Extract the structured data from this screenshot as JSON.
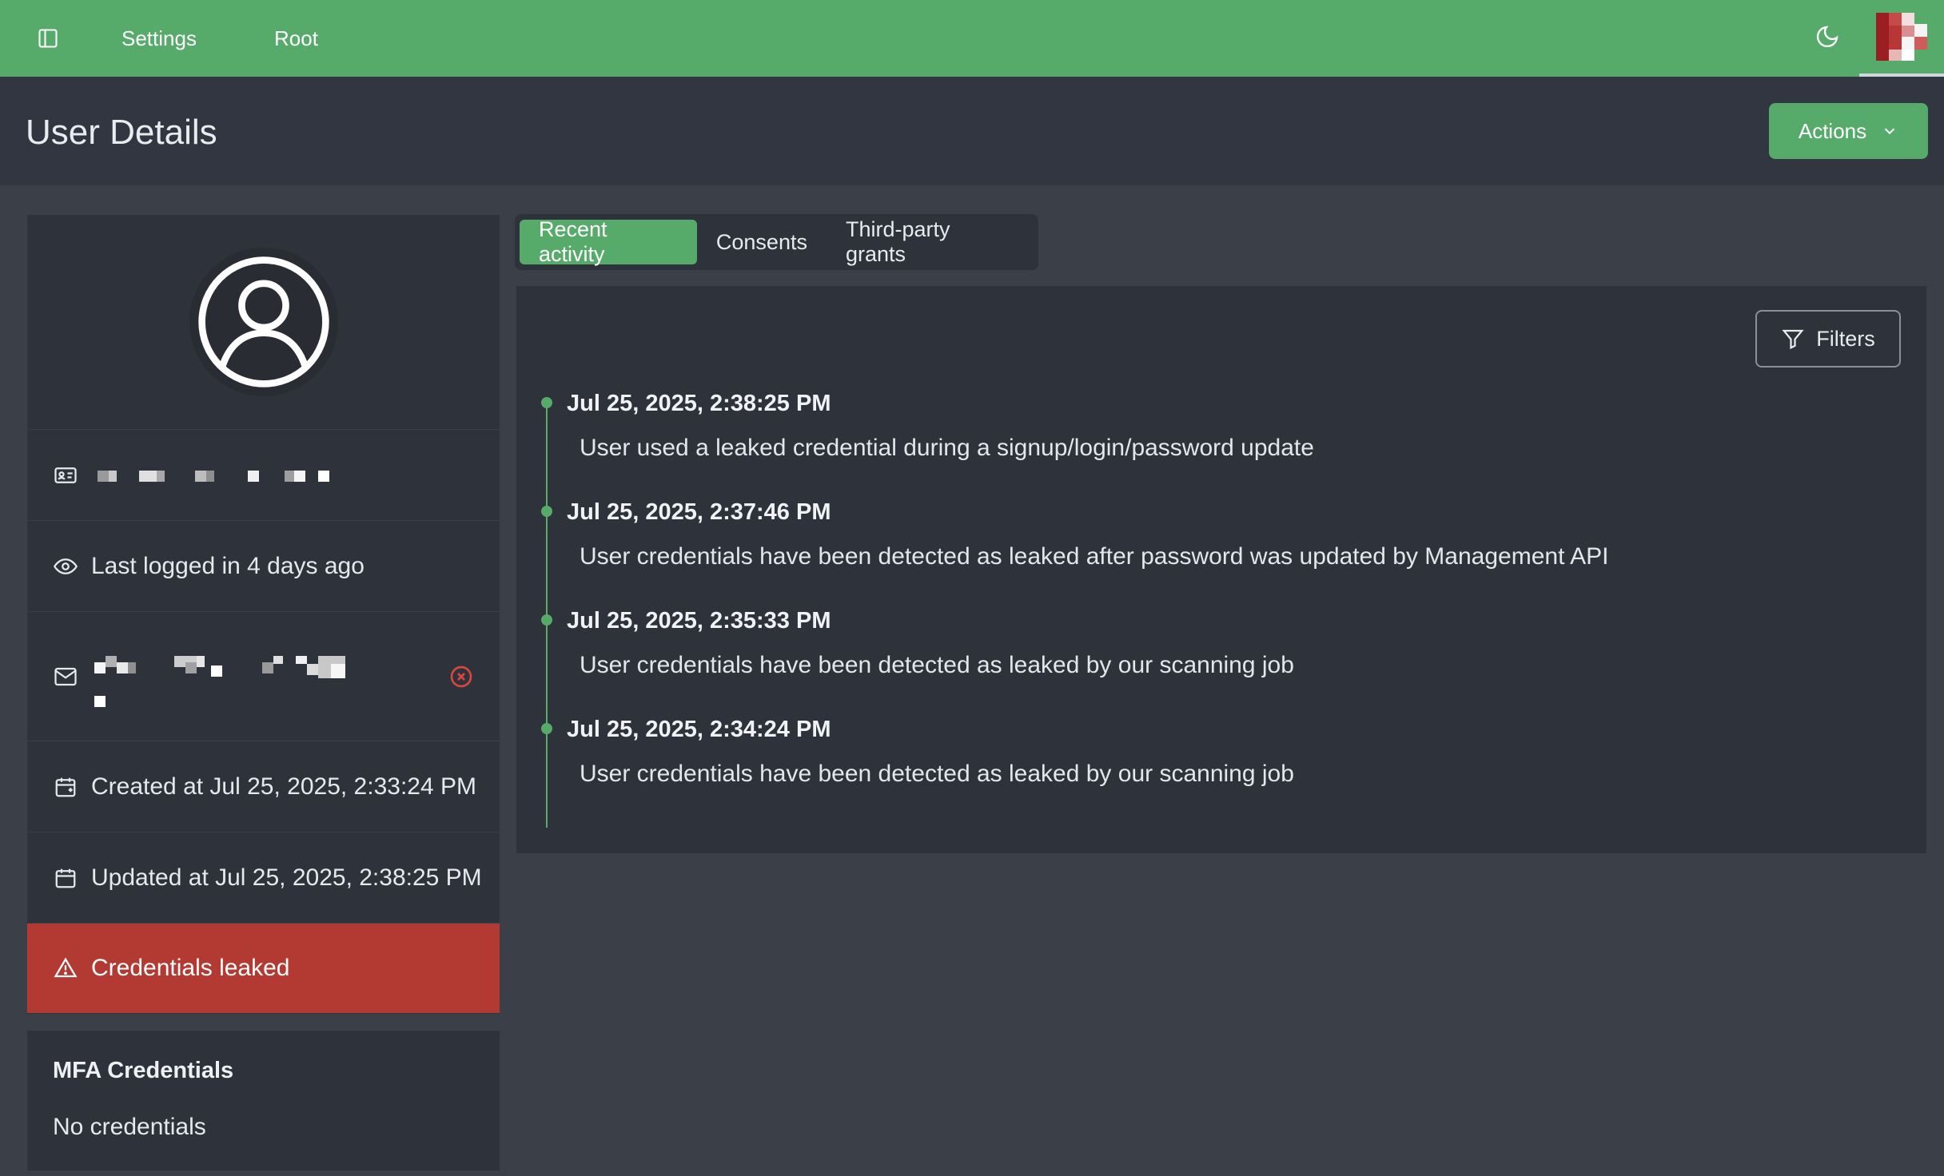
{
  "topbar": {
    "nav": [
      "Settings",
      "Root"
    ],
    "icons": [
      "sidebar-toggle-icon",
      "moon-icon"
    ],
    "accent": "#57ab6a"
  },
  "header": {
    "title": "User Details",
    "actions_label": "Actions"
  },
  "profile": {
    "last_login": "Last logged in 4 days ago",
    "created": "Created at Jul 25, 2025, 2:33:24 PM",
    "updated": "Updated at Jul 25, 2025, 2:38:25 PM",
    "status": "Credentials leaked",
    "status_color": "#b23a33"
  },
  "mfa": {
    "title": "MFA Credentials",
    "empty": "No credentials"
  },
  "tabs": [
    "Recent activity",
    "Consents",
    "Third-party grants"
  ],
  "activity": {
    "filters_label": "Filters",
    "events": [
      {
        "timestamp": "Jul 25, 2025, 2:38:25 PM",
        "message": "User used a leaked credential during a signup/login/password update"
      },
      {
        "timestamp": "Jul 25, 2025, 2:37:46 PM",
        "message": "User credentials have been detected as leaked after password was updated by Management API"
      },
      {
        "timestamp": "Jul 25, 2025, 2:35:33 PM",
        "message": "User credentials have been detected as leaked by our scanning job"
      },
      {
        "timestamp": "Jul 25, 2025, 2:34:24 PM",
        "message": "User credentials have been detected as leaked by our scanning job"
      }
    ]
  }
}
